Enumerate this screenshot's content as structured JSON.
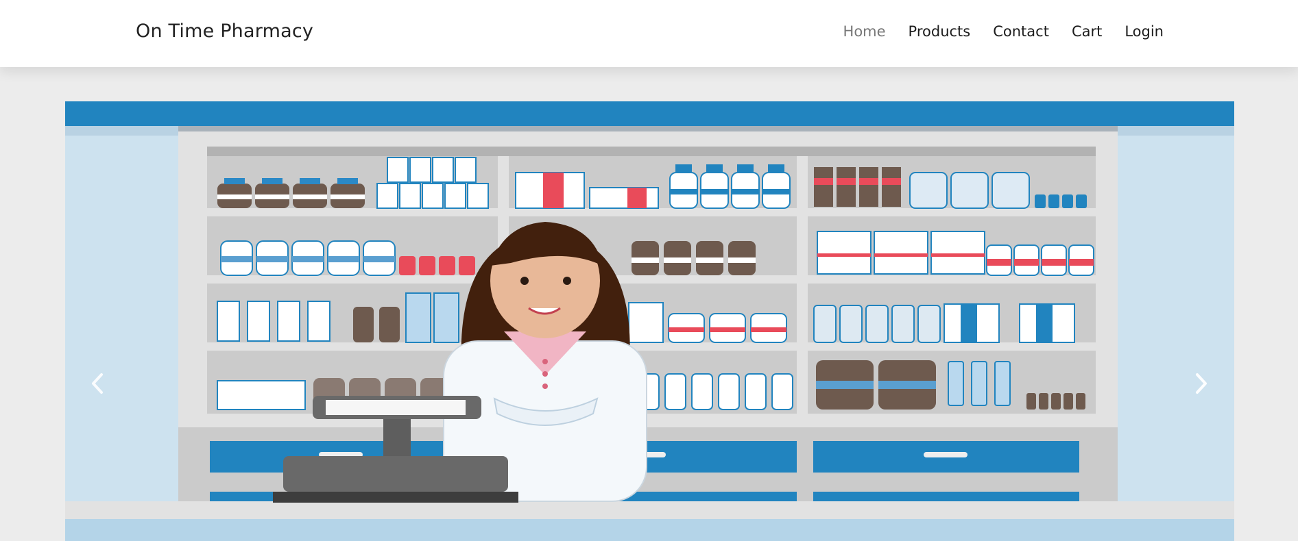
{
  "navbar": {
    "brand": "On Time Pharmacy",
    "links": [
      {
        "label": "Home",
        "active": true
      },
      {
        "label": "Products",
        "active": false
      },
      {
        "label": "Contact",
        "active": false
      },
      {
        "label": "Cart",
        "active": false
      },
      {
        "label": "Login",
        "active": false
      }
    ]
  },
  "carousel": {
    "image_subject": "pharmacist-at-counter-illustration",
    "prev_icon": "chevron-left-icon",
    "next_icon": "chevron-right-icon"
  },
  "colors": {
    "brand_blue": "#2184bf",
    "light_blue": "#cde2ef",
    "shelf_gray": "#cbcbcb",
    "page_bg": "#ececec",
    "nav_active": "#777777",
    "accent_red": "#e94b5a",
    "brown": "#6e5a4e"
  }
}
